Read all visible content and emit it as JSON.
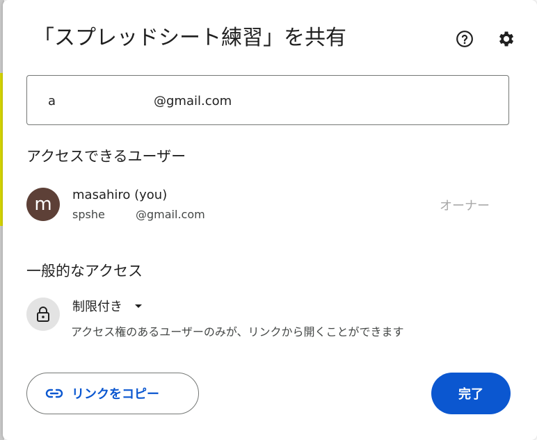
{
  "dialog": {
    "title": "「スプレッドシート練習」を共有",
    "help_icon": "help-circle-icon",
    "settings_icon": "gear-icon"
  },
  "share_input": {
    "chip_prefix": "a",
    "chip_domain": "@gmail.com"
  },
  "users_section": {
    "title": "アクセスできるユーザー",
    "users": [
      {
        "avatar_letter": "m",
        "avatar_color": "#5d4037",
        "name": "masahiro (you)",
        "email_prefix": "spshe",
        "email_domain": "@gmail.com",
        "role": "オーナー"
      }
    ]
  },
  "general_access": {
    "title": "一般的なアクセス",
    "icon": "lock-icon",
    "selected": "制限付き",
    "description": "アクセス権のあるユーザーのみが、リンクから開くことができます"
  },
  "footer": {
    "copy_link_label": "リンクをコピー",
    "copy_link_icon": "link-icon",
    "done_label": "完了"
  },
  "colors": {
    "accent": "#0b57d0",
    "text_primary": "#1f1f1f",
    "text_secondary": "#444746",
    "role_text": "#a8a8a8"
  }
}
